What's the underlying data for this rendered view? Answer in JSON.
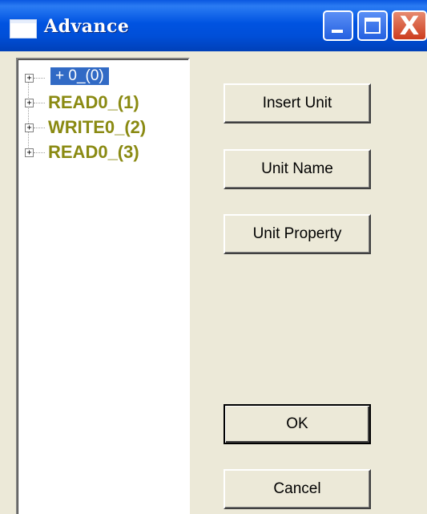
{
  "window": {
    "title": "Advance"
  },
  "titlebar": {
    "min_icon": "minimize-icon",
    "max_icon": "maximize-icon",
    "close_icon": "close-icon",
    "close_glyph": "X"
  },
  "tree": {
    "expander_glyph": "+",
    "nodes": [
      {
        "label": "+ 0_(0)",
        "selected": true
      },
      {
        "label": "READ0_(1)",
        "selected": false
      },
      {
        "label": "WRITE0_(2)",
        "selected": false
      },
      {
        "label": "READ0_(3)",
        "selected": false
      }
    ]
  },
  "buttons": {
    "insert_unit": "Insert Unit",
    "unit_name": "Unit Name",
    "unit_property": "Unit Property",
    "ok": "OK",
    "cancel": "Cancel"
  },
  "colors": {
    "title_bar": "#0053e1",
    "selection": "#316ac5",
    "node_text": "#8a8a12",
    "dialog_bg": "#ece9d8"
  }
}
